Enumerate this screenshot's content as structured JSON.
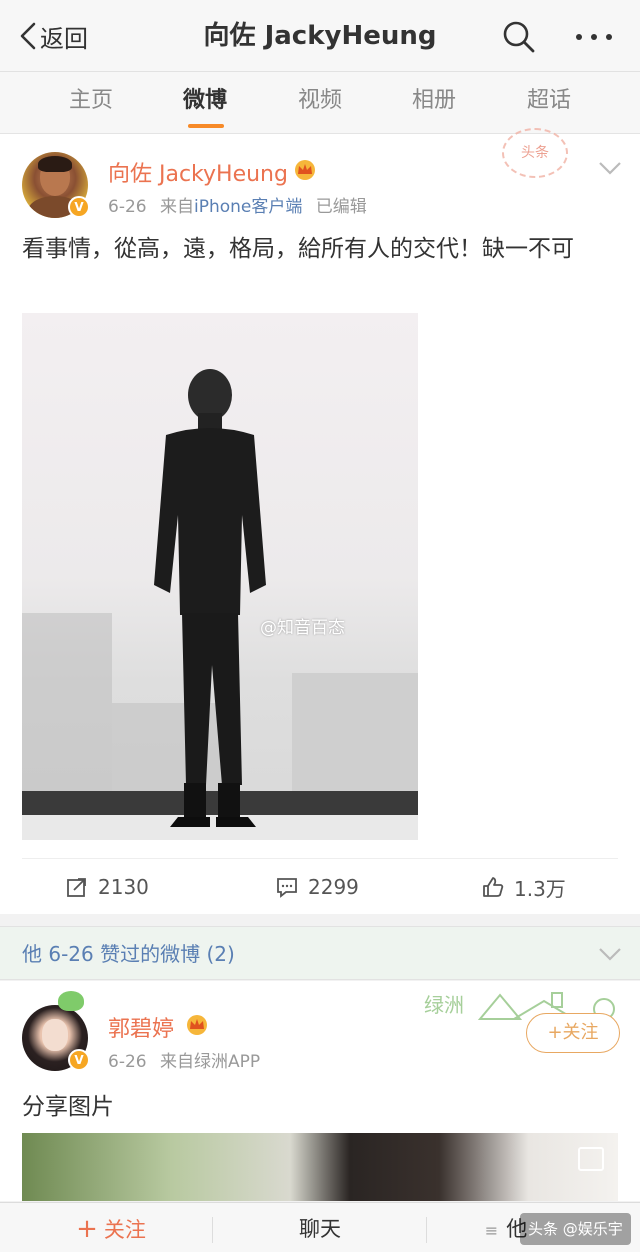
{
  "nav": {
    "back_label": "返回",
    "title": "向佐 JackyHeung"
  },
  "tabs": [
    "主页",
    "微博",
    "视频",
    "相册",
    "超话"
  ],
  "active_tab": "微博",
  "colors": {
    "accent": "#f78a28",
    "name": "#eb7350",
    "link": "#5a7fb3",
    "follow": "#e8a862"
  },
  "post": {
    "user_name": "向佐 JackyHeung",
    "date": "6-26",
    "from_prefix": "来自",
    "source": "iPhone客户端",
    "edited": "已编辑",
    "stamp": "头条",
    "text": "看事情，從高，遠，格局，給所有人的交代！缺一不可",
    "watermark": "@知音百态",
    "reposts": "2130",
    "comments": "2299",
    "likes": "1.3万"
  },
  "liked_section": {
    "title": "他 6-26 赞过的微博 (2)"
  },
  "post2": {
    "user_name": "郭碧婷",
    "date": "6-26",
    "source": "来自绿洲APP",
    "oasis": "绿洲",
    "follow_label": "+关注",
    "text": "分享图片"
  },
  "bottom_bar": {
    "follow": "关注",
    "chat": "聊天",
    "other": "他",
    "toutiao": "头条 @娱乐宇"
  }
}
